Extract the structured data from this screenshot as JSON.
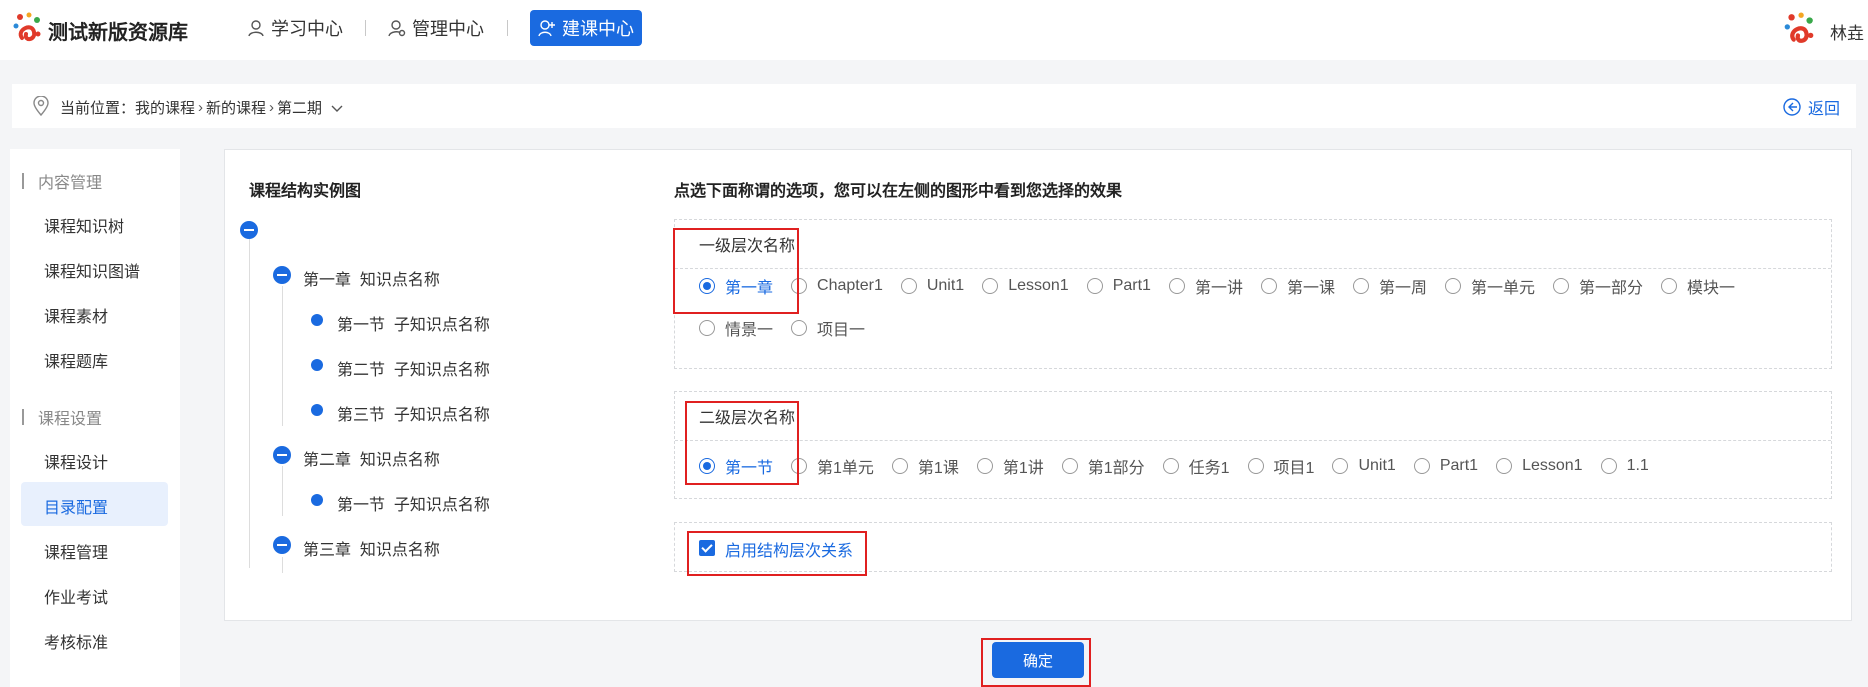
{
  "header": {
    "brand": "测试新版资源库",
    "nav": [
      {
        "label": "学习中心",
        "icon": "learning-person-icon"
      },
      {
        "label": "管理中心",
        "icon": "manage-person-icon"
      },
      {
        "label": "建课中心",
        "icon": "build-course-icon",
        "active": true
      }
    ],
    "user": "林垚"
  },
  "breadcrumb": {
    "prefix": "当前位置：",
    "items": [
      "我的课程",
      "新的课程",
      "第二期"
    ],
    "back": "返回"
  },
  "sidebar": {
    "groups": [
      {
        "title": "内容管理",
        "items": [
          "课程知识树",
          "课程知识图谱",
          "课程素材",
          "课程题库"
        ]
      },
      {
        "title": "课程设置",
        "items": [
          "课程设计",
          "目录配置",
          "课程管理",
          "作业考试",
          "考核标准"
        ]
      }
    ],
    "active": "目录配置"
  },
  "tree": {
    "title": "课程结构实例图",
    "nodes": [
      {
        "level": 1,
        "label": "第一章  知识点名称"
      },
      {
        "level": 2,
        "label": "第一节  子知识点名称"
      },
      {
        "level": 2,
        "label": "第二节  子知识点名称"
      },
      {
        "level": 2,
        "label": "第三节  子知识点名称"
      },
      {
        "level": 1,
        "label": "第二章  知识点名称"
      },
      {
        "level": 2,
        "label": "第一节  子知识点名称"
      },
      {
        "level": 1,
        "label": "第三章  知识点名称"
      }
    ]
  },
  "settings": {
    "title": "点选下面称谓的选项，您可以在左侧的图形中看到您选择的效果",
    "level1": {
      "label": "一级层次名称",
      "options": [
        "第一章",
        "Chapter1",
        "Unit1",
        "Lesson1",
        "Part1",
        "第一讲",
        "第一课",
        "第一周",
        "第一单元",
        "第一部分",
        "模块一",
        "情景一",
        "项目一"
      ],
      "selected": "第一章"
    },
    "level2": {
      "label": "二级层次名称",
      "options": [
        "第一节",
        "第1单元",
        "第1课",
        "第1讲",
        "第1部分",
        "任务1",
        "项目1",
        "Unit1",
        "Part1",
        "Lesson1",
        "1.1"
      ],
      "selected": "第一节"
    },
    "hierarchy_checkbox": {
      "label": "启用结构层次关系",
      "checked": true
    }
  },
  "confirm": "确定",
  "colors": {
    "accent": "#1a6ae0",
    "highlight": "#e02020"
  }
}
